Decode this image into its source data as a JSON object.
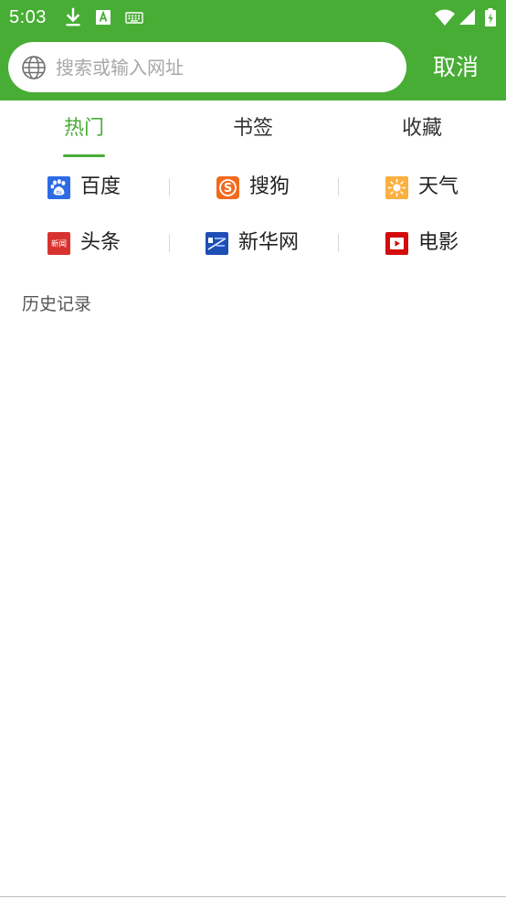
{
  "status_bar": {
    "time": "5:03",
    "icons": [
      "download-icon",
      "a-keyboard-icon",
      "keyboard-icon",
      "wifi-icon",
      "cellular-signal-icon",
      "battery-charging-icon"
    ]
  },
  "header": {
    "search": {
      "placeholder": "搜索或输入网址",
      "value": "",
      "icon": "globe-icon"
    },
    "cancel_label": "取消",
    "background_color": "#48ad35"
  },
  "tabs": [
    {
      "label": "热门",
      "active": true
    },
    {
      "label": "书签",
      "active": false
    },
    {
      "label": "收藏",
      "active": false
    }
  ],
  "quick_links": [
    {
      "label": "百度",
      "icon": "baidu-icon"
    },
    {
      "label": "搜狗",
      "icon": "sogou-icon"
    },
    {
      "label": "天气",
      "icon": "weather-icon"
    },
    {
      "label": "头条",
      "icon": "toutiao-icon",
      "icon_text": "新闻"
    },
    {
      "label": "新华网",
      "icon": "xinhua-icon"
    },
    {
      "label": "电影",
      "icon": "movie-icon"
    }
  ],
  "history": {
    "title": "历史记录"
  },
  "colors": {
    "accent": "#48ad35",
    "text": "#222222",
    "muted": "#555555"
  }
}
